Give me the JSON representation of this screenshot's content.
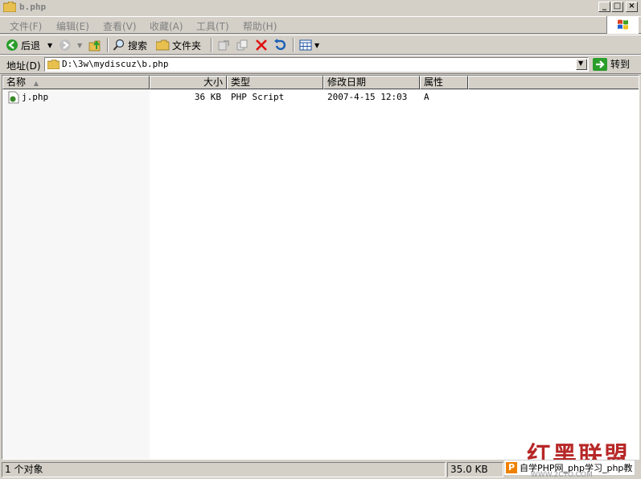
{
  "window": {
    "title": "b.php"
  },
  "menu": [
    {
      "label": "文件(F)"
    },
    {
      "label": "编辑(E)"
    },
    {
      "label": "查看(V)"
    },
    {
      "label": "收藏(A)"
    },
    {
      "label": "工具(T)"
    },
    {
      "label": "帮助(H)"
    }
  ],
  "toolbar": {
    "back_label": "后退",
    "search_label": "搜索",
    "folders_label": "文件夹"
  },
  "address": {
    "label": "地址(D)",
    "value": "D:\\3w\\mydiscuz\\b.php",
    "go_label": "转到"
  },
  "columns": [
    {
      "label": "名称"
    },
    {
      "label": "大小"
    },
    {
      "label": "类型"
    },
    {
      "label": "修改日期"
    },
    {
      "label": "属性"
    }
  ],
  "files": [
    {
      "name": "j.php",
      "size": "36 KB",
      "type": "PHP Script",
      "modified": "2007-4-15 12:03",
      "attributes": "A"
    }
  ],
  "status": {
    "count": "1 个对象",
    "size": "35.0 KB"
  },
  "watermarks": {
    "red_text": "红黑联盟",
    "box_text": "自学PHP网_php学习_php教",
    "box_icon": "P",
    "url_text": "WWW.2CTO.COM"
  },
  "colors": {
    "chrome": "#d4d0c8",
    "back_green": "#2a9d2a",
    "delete_red": "#e01010",
    "watermark_red": "#b01010"
  }
}
